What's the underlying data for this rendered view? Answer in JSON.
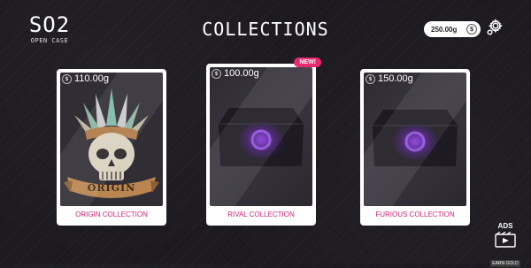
{
  "logo": {
    "main": "SO2",
    "sub": "OPEN CASE"
  },
  "title": "COLLECTIONS",
  "balance": {
    "value": "250.00g"
  },
  "icons": {
    "coin": "coin-icon",
    "gear": "gear-icon",
    "ads": "video-ad-icon"
  },
  "cards": [
    {
      "price": "110.00g",
      "label": "ORIGIN COLLECTION",
      "art_text": "ORIGIN",
      "badge": ""
    },
    {
      "price": "100.00g",
      "label": "RIVAL COLLECTION",
      "art_text": "",
      "badge": "NEW!"
    },
    {
      "price": "150.00g",
      "label": "FURIOUS COLLECTION",
      "art_text": "",
      "badge": ""
    }
  ],
  "ads": {
    "label": "ADS",
    "sub": "EARN GOLD"
  },
  "colors": {
    "accent": "#e8286f",
    "label_text": "#d4237a",
    "background": "#1c1a1f",
    "case_glow": "#7b2fd0"
  }
}
